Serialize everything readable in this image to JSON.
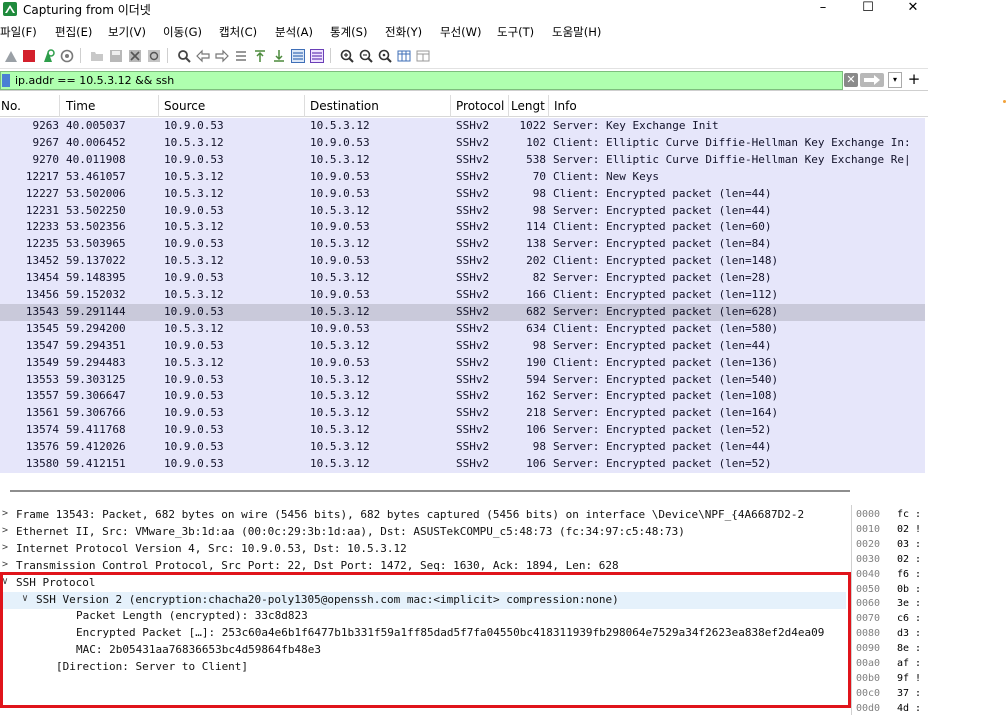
{
  "window": {
    "title": "Capturing from 이더넷",
    "controls": {
      "minimize": "–",
      "maximize": "☐",
      "close": "✕"
    }
  },
  "menu": [
    "파일(F)",
    "편집(E)",
    "보기(V)",
    "이동(G)",
    "캡처(C)",
    "분석(A)",
    "통계(S)",
    "전화(Y)",
    "무선(W)",
    "도구(T)",
    "도움말(H)"
  ],
  "toolbar": {
    "icons": [
      "shark-fin-icon",
      "stop-capture-icon",
      "restart-capture-icon",
      "capture-options-icon",
      "open-file-icon",
      "save-file-icon",
      "close-file-icon",
      "reload-icon",
      "find-packet-icon",
      "go-back-icon",
      "go-forward-icon",
      "go-to-packet-icon",
      "go-first-icon",
      "go-last-icon",
      "auto-scroll-icon",
      "colorize-icon",
      "zoom-in-icon",
      "zoom-out-icon",
      "zoom-normal-icon",
      "resize-columns-icon",
      "layout-icon"
    ]
  },
  "filter": {
    "value": "ip.addr == 10.5.3.12 && ssh",
    "clear_glyph": "✕",
    "dropdown_glyph": "▾",
    "add_glyph": "+"
  },
  "packet_list": {
    "columns": [
      "No.",
      "Time",
      "Source",
      "Destination",
      "Protocol",
      "Lengt",
      "Info"
    ],
    "rows": [
      {
        "no": "9263",
        "time": "40.005037",
        "src": "10.9.0.53",
        "dst": "10.5.3.12",
        "proto": "SSHv2",
        "len": "1022",
        "info": "Server: Key Exchange Init"
      },
      {
        "no": "9267",
        "time": "40.006452",
        "src": "10.5.3.12",
        "dst": "10.9.0.53",
        "proto": "SSHv2",
        "len": "102",
        "info": "Client: Elliptic Curve Diffie-Hellman Key Exchange In:"
      },
      {
        "no": "9270",
        "time": "40.011908",
        "src": "10.9.0.53",
        "dst": "10.5.3.12",
        "proto": "SSHv2",
        "len": "538",
        "info": "Server: Elliptic Curve Diffie-Hellman Key Exchange Re|"
      },
      {
        "no": "12217",
        "time": "53.461057",
        "src": "10.5.3.12",
        "dst": "10.9.0.53",
        "proto": "SSHv2",
        "len": "70",
        "info": "Client: New Keys"
      },
      {
        "no": "12227",
        "time": "53.502006",
        "src": "10.5.3.12",
        "dst": "10.9.0.53",
        "proto": "SSHv2",
        "len": "98",
        "info": "Client: Encrypted packet (len=44)"
      },
      {
        "no": "12231",
        "time": "53.502250",
        "src": "10.9.0.53",
        "dst": "10.5.3.12",
        "proto": "SSHv2",
        "len": "98",
        "info": "Server: Encrypted packet (len=44)"
      },
      {
        "no": "12233",
        "time": "53.502356",
        "src": "10.5.3.12",
        "dst": "10.9.0.53",
        "proto": "SSHv2",
        "len": "114",
        "info": "Client: Encrypted packet (len=60)"
      },
      {
        "no": "12235",
        "time": "53.503965",
        "src": "10.9.0.53",
        "dst": "10.5.3.12",
        "proto": "SSHv2",
        "len": "138",
        "info": "Server: Encrypted packet (len=84)"
      },
      {
        "no": "13452",
        "time": "59.137022",
        "src": "10.5.3.12",
        "dst": "10.9.0.53",
        "proto": "SSHv2",
        "len": "202",
        "info": "Client: Encrypted packet (len=148)"
      },
      {
        "no": "13454",
        "time": "59.148395",
        "src": "10.9.0.53",
        "dst": "10.5.3.12",
        "proto": "SSHv2",
        "len": "82",
        "info": "Server: Encrypted packet (len=28)"
      },
      {
        "no": "13456",
        "time": "59.152032",
        "src": "10.5.3.12",
        "dst": "10.9.0.53",
        "proto": "SSHv2",
        "len": "166",
        "info": "Client: Encrypted packet (len=112)"
      },
      {
        "no": "13543",
        "time": "59.291144",
        "src": "10.9.0.53",
        "dst": "10.5.3.12",
        "proto": "SSHv2",
        "len": "682",
        "info": "Server: Encrypted packet (len=628)",
        "selected": true
      },
      {
        "no": "13545",
        "time": "59.294200",
        "src": "10.5.3.12",
        "dst": "10.9.0.53",
        "proto": "SSHv2",
        "len": "634",
        "info": "Client: Encrypted packet (len=580)"
      },
      {
        "no": "13547",
        "time": "59.294351",
        "src": "10.9.0.53",
        "dst": "10.5.3.12",
        "proto": "SSHv2",
        "len": "98",
        "info": "Server: Encrypted packet (len=44)"
      },
      {
        "no": "13549",
        "time": "59.294483",
        "src": "10.5.3.12",
        "dst": "10.9.0.53",
        "proto": "SSHv2",
        "len": "190",
        "info": "Client: Encrypted packet (len=136)"
      },
      {
        "no": "13553",
        "time": "59.303125",
        "src": "10.9.0.53",
        "dst": "10.5.3.12",
        "proto": "SSHv2",
        "len": "594",
        "info": "Server: Encrypted packet (len=540)"
      },
      {
        "no": "13557",
        "time": "59.306647",
        "src": "10.9.0.53",
        "dst": "10.5.3.12",
        "proto": "SSHv2",
        "len": "162",
        "info": "Server: Encrypted packet (len=108)"
      },
      {
        "no": "13561",
        "time": "59.306766",
        "src": "10.9.0.53",
        "dst": "10.5.3.12",
        "proto": "SSHv2",
        "len": "218",
        "info": "Server: Encrypted packet (len=164)"
      },
      {
        "no": "13574",
        "time": "59.411768",
        "src": "10.9.0.53",
        "dst": "10.5.3.12",
        "proto": "SSHv2",
        "len": "106",
        "info": "Server: Encrypted packet (len=52)"
      },
      {
        "no": "13576",
        "time": "59.412026",
        "src": "10.9.0.53",
        "dst": "10.5.3.12",
        "proto": "SSHv2",
        "len": "98",
        "info": "Server: Encrypted packet (len=44)"
      },
      {
        "no": "13580",
        "time": "59.412151",
        "src": "10.9.0.53",
        "dst": "10.5.3.12",
        "proto": "SSHv2",
        "len": "106",
        "info": "Server: Encrypted packet (len=52)"
      }
    ]
  },
  "details": [
    {
      "arrow": ">",
      "indent": 0,
      "text": "Frame 13543: Packet, 682 bytes on wire (5456 bits), 682 bytes captured (5456 bits) on interface \\Device\\NPF_{4A6687D2-2"
    },
    {
      "arrow": ">",
      "indent": 0,
      "text": "Ethernet II, Src: VMware_3b:1d:aa (00:0c:29:3b:1d:aa), Dst: ASUSTekCOMPU_c5:48:73 (fc:34:97:c5:48:73)"
    },
    {
      "arrow": ">",
      "indent": 0,
      "text": "Internet Protocol Version 4, Src: 10.9.0.53, Dst: 10.5.3.12"
    },
    {
      "arrow": ">",
      "indent": 0,
      "text": "Transmission Control Protocol, Src Port: 22, Dst Port: 1472, Seq: 1630, Ack: 1894, Len: 628"
    },
    {
      "arrow": "∨",
      "indent": 0,
      "text": "SSH Protocol"
    },
    {
      "arrow": "∨",
      "indent": 1,
      "text": "SSH Version 2 (encryption:chacha20-poly1305@openssh.com mac:<implicit> compression:none)",
      "highlight": true
    },
    {
      "arrow": "",
      "indent": 3,
      "text": "Packet Length (encrypted): 33c8d823"
    },
    {
      "arrow": "",
      "indent": 3,
      "text": "Encrypted Packet […]: 253c60a4e6b1f6477b1b331f59a1ff85dad5f7fa04550bc418311939fb298064e7529a34f2623ea838ef2d4ea09"
    },
    {
      "arrow": "",
      "indent": 3,
      "text": "MAC: 2b05431aa76836653bc4d59864fb48e3"
    },
    {
      "arrow": "",
      "indent": 2,
      "text": "[Direction: Server to Client]"
    }
  ],
  "bytes": [
    {
      "offset": "0000",
      "hex": "fc :"
    },
    {
      "offset": "0010",
      "hex": "02 !"
    },
    {
      "offset": "0020",
      "hex": "03 :"
    },
    {
      "offset": "0030",
      "hex": "02 :"
    },
    {
      "offset": "0040",
      "hex": "f6 :"
    },
    {
      "offset": "0050",
      "hex": "0b :"
    },
    {
      "offset": "0060",
      "hex": "3e :"
    },
    {
      "offset": "0070",
      "hex": "c6 :"
    },
    {
      "offset": "0080",
      "hex": "d3 :"
    },
    {
      "offset": "0090",
      "hex": "8e :"
    },
    {
      "offset": "00a0",
      "hex": "af :"
    },
    {
      "offset": "00b0",
      "hex": "9f !"
    },
    {
      "offset": "00c0",
      "hex": "37 :"
    },
    {
      "offset": "00d0",
      "hex": "4d :"
    }
  ],
  "colors": {
    "row_bg": "#e6e6fa",
    "selected_row_bg": "#c9c9da",
    "filter_ok_bg": "#afffaf",
    "annotation_red": "#e0141b"
  }
}
